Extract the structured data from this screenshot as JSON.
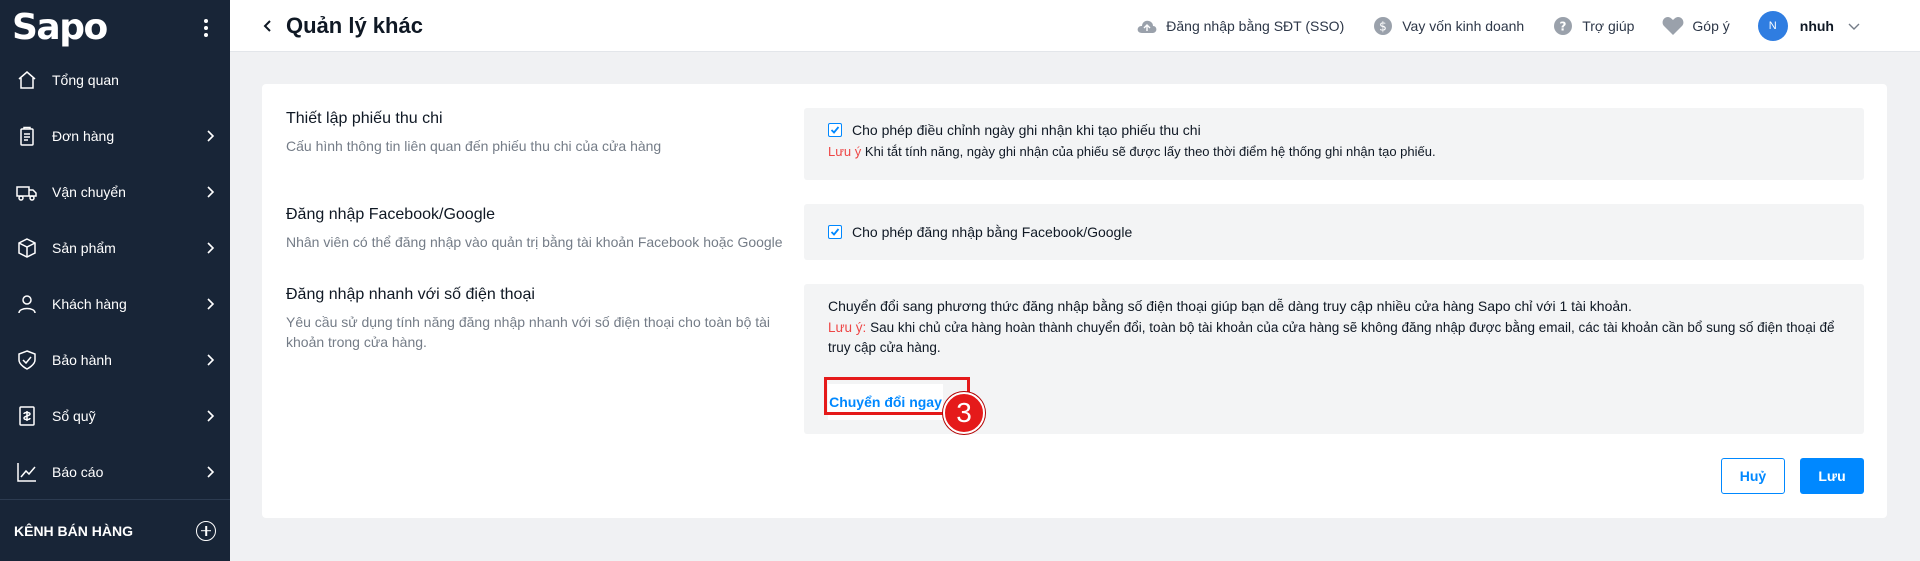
{
  "sidebar": {
    "logo": "Sapo",
    "items": [
      {
        "label": "Tổng quan",
        "icon": "home-icon"
      },
      {
        "label": "Đơn hàng",
        "icon": "clipboard-icon"
      },
      {
        "label": "Vận chuyển",
        "icon": "truck-icon"
      },
      {
        "label": "Sản phẩm",
        "icon": "box-icon"
      },
      {
        "label": "Khách hàng",
        "icon": "user-icon"
      },
      {
        "label": "Bảo hành",
        "icon": "shield-icon"
      },
      {
        "label": "Sổ quỹ",
        "icon": "cashbook-icon"
      },
      {
        "label": "Báo cáo",
        "icon": "chart-icon"
      }
    ],
    "channels_label": "KÊNH BÁN HÀNG"
  },
  "header": {
    "title": "Quản lý khác",
    "links": {
      "sso": "Đăng nhập bằng SĐT (SSO)",
      "loan": "Vay vốn kinh doanh",
      "help": "Trợ giúp",
      "feedback": "Góp ý"
    },
    "user": {
      "initial": "N",
      "name": "nhuh"
    }
  },
  "sections": {
    "receipts": {
      "title": "Thiết lập phiếu thu chi",
      "description": "Cấu hình thông tin liên quan đến phiếu thu chi của cửa hàng",
      "checkbox_label": "Cho phép điều chỉnh ngày ghi nhận khi tạo phiếu thu chi",
      "checked": true,
      "note_prefix": "Lưu ý",
      "note_text": " Khi tắt tính năng, ngày ghi nhận của phiếu sẽ được lấy theo thời điểm hệ thống ghi nhận tạo phiếu."
    },
    "social": {
      "title": "Đăng nhập Facebook/Google",
      "description": "Nhân viên có thể đăng nhập vào quản trị bằng tài khoản Facebook hoặc Google",
      "checkbox_label": "Cho phép đăng nhập bằng Facebook/Google",
      "checked": true
    },
    "phone": {
      "title": "Đăng nhập nhanh với số điện thoại",
      "description": "Yêu cầu sử dụng tính năng đăng nhập nhanh với số điện thoại cho toàn bộ tài khoản trong cửa hàng.",
      "info_text": "Chuyển đổi sang phương thức đăng nhập bằng số điện thoại giúp bạn dễ dàng truy cập nhiều cửa hàng Sapo chỉ với 1 tài khoản.",
      "note_prefix": "Lưu ý:",
      "note_text": " Sau khi chủ cửa hàng hoàn thành chuyển đổi, toàn bộ tài khoản của cửa hàng sẽ không đăng nhập được bằng email, các tài khoản cần bổ sung số điện thoại để truy cập cửa hàng.",
      "convert_button": "Chuyển đổi ngay"
    }
  },
  "annotation": {
    "step": "3",
    "color": "#e51a1a"
  },
  "actions": {
    "cancel": "Huỷ",
    "save": "Lưu"
  },
  "colors": {
    "sidebar": "#182537",
    "accent": "#0088ff",
    "warning": "#ee4747"
  }
}
